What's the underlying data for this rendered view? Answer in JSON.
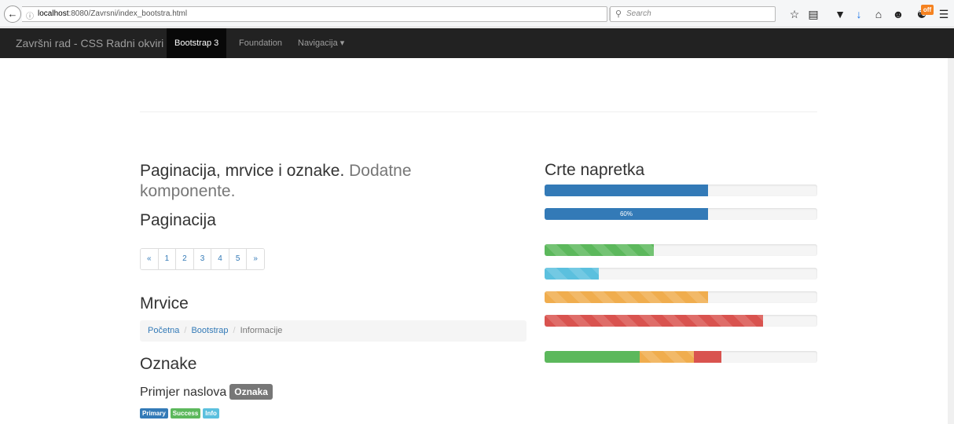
{
  "browser": {
    "url_info_icon": "info-icon",
    "url_host": "localhost",
    "url_rest": ":8080/Zavrsni/index_bootstra.html",
    "reload_glyph": "C",
    "search_placeholder": "Search"
  },
  "navbar": {
    "brand": "Završni rad - CSS Radni okviri",
    "items": [
      {
        "label": "Bootstrap 3",
        "active": true
      },
      {
        "label": "Foundation",
        "active": false
      },
      {
        "label": "Navigacija ▾",
        "active": false
      }
    ]
  },
  "section": {
    "title_main": "Paginacija, mrvice i oznake.",
    "title_muted_1": "Dodatne",
    "title_muted_2": "komponente."
  },
  "pagination": {
    "heading": "Paginacija",
    "items": [
      "«",
      "1",
      "2",
      "3",
      "4",
      "5",
      "»"
    ]
  },
  "breadcrumb": {
    "heading": "Mrvice",
    "items": [
      "Početna",
      "Bootstrap",
      "Informacije"
    ],
    "separator": "/"
  },
  "labels": {
    "heading": "Oznake",
    "example_title": "Primjer naslova",
    "example_label": "Oznaka",
    "mini": [
      {
        "text": "Primary",
        "color": "#337ab7"
      },
      {
        "text": "Success",
        "color": "#5cb85c"
      },
      {
        "text": "Info",
        "color": "#5bc0de"
      }
    ]
  },
  "progress": {
    "heading": "Crte napretka",
    "bars": [
      {
        "segments": [
          {
            "value": 60,
            "color": "#337ab7",
            "striped": false
          }
        ],
        "label": ""
      },
      {
        "segments": [
          {
            "value": 60,
            "color": "#337ab7",
            "striped": false
          }
        ],
        "label": "60%"
      },
      {
        "segments": [
          {
            "value": 40,
            "color": "#5cb85c",
            "striped": true
          }
        ],
        "label": ""
      },
      {
        "segments": [
          {
            "value": 20,
            "color": "#5bc0de",
            "striped": true
          }
        ],
        "label": ""
      },
      {
        "segments": [
          {
            "value": 60,
            "color": "#f0ad4e",
            "striped": true
          }
        ],
        "label": ""
      },
      {
        "segments": [
          {
            "value": 80,
            "color": "#d9534f",
            "striped": true
          }
        ],
        "label": ""
      },
      {
        "segments": [
          {
            "value": 35,
            "color": "#5cb85c",
            "striped": false
          },
          {
            "value": 20,
            "color": "#f0ad4e",
            "striped": true
          },
          {
            "value": 10,
            "color": "#d9534f",
            "striped": false
          }
        ],
        "label": ""
      }
    ]
  }
}
